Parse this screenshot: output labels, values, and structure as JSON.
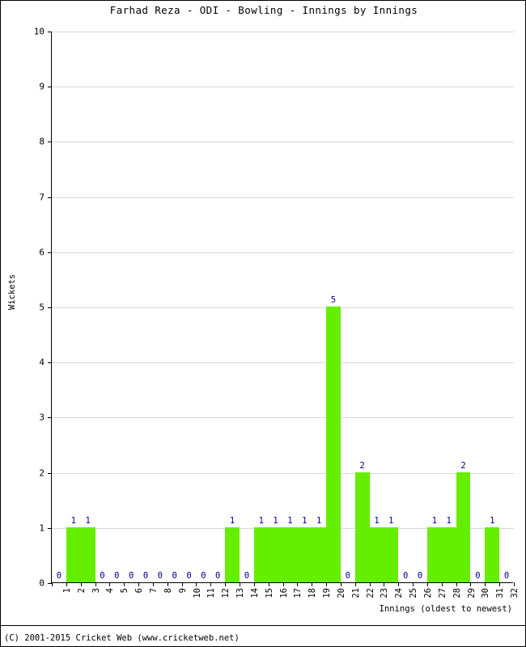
{
  "title": "Farhad Reza - ODI - Bowling - Innings by Innings",
  "axes": {
    "y_title": "Wickets",
    "x_title": "Innings (oldest to newest)"
  },
  "footer": "(C) 2001-2015 Cricket Web (www.cricketweb.net)",
  "colors": {
    "bar": "#66ee00",
    "value_label": "#00008b",
    "grid": "#d8d8d8",
    "axis": "#000000",
    "background": "#ffffff"
  },
  "chart_data": {
    "type": "bar",
    "title": "Farhad Reza - ODI - Bowling - Innings by Innings",
    "xlabel": "Innings (oldest to newest)",
    "ylabel": "Wickets",
    "ylim": [
      0,
      10
    ],
    "yticks": [
      0,
      1,
      2,
      3,
      4,
      5,
      6,
      7,
      8,
      9,
      10
    ],
    "grid": true,
    "legend": "none",
    "categories": [
      "1",
      "2",
      "3",
      "4",
      "5",
      "6",
      "7",
      "8",
      "9",
      "10",
      "11",
      "12",
      "13",
      "14",
      "15",
      "16",
      "17",
      "18",
      "19",
      "20",
      "21",
      "22",
      "23",
      "24",
      "25",
      "26",
      "27",
      "28",
      "29",
      "30",
      "31",
      "32"
    ],
    "values": [
      0,
      1,
      1,
      0,
      0,
      0,
      0,
      0,
      0,
      0,
      0,
      0,
      1,
      0,
      1,
      1,
      1,
      1,
      1,
      5,
      0,
      2,
      1,
      1,
      0,
      0,
      1,
      1,
      2,
      0,
      1,
      0
    ],
    "data_labels": [
      "0",
      "1",
      "1",
      "0",
      "0",
      "0",
      "0",
      "0",
      "0",
      "0",
      "0",
      "0",
      "1",
      "0",
      "1",
      "1",
      "1",
      "1",
      "1",
      "5",
      "0",
      "2",
      "1",
      "1",
      "0",
      "0",
      "1",
      "1",
      "2",
      "0",
      "1",
      "0"
    ]
  }
}
